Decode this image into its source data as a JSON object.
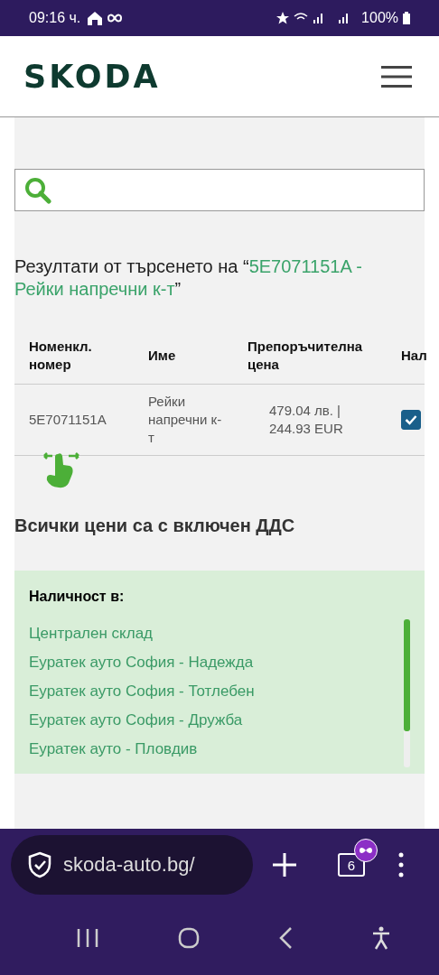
{
  "status_bar": {
    "time": "09:16 ч.",
    "battery": "100%"
  },
  "header": {
    "logo": "SKODA"
  },
  "results_heading": {
    "prefix": "Резултати от търсенето на “",
    "query": "5E7071151A - Рейки напречни к-т",
    "suffix": "”"
  },
  "table": {
    "columns": [
      "Номенкл. номер",
      "Име",
      "Препоръчителна цена",
      "Нал"
    ],
    "rows": [
      {
        "cells": [
          "5E7071151A",
          "Рейки напречни к-т",
          "479.04 лв. | 244.93 EUR"
        ],
        "checked": true
      }
    ]
  },
  "vat_note": "Всички цени са с включен ДДС",
  "availability": {
    "title": "Наличност в:",
    "items": [
      "Централен склад",
      "Еуратек ауто София - Надежда",
      "Еуратек ауто София - Тотлебен",
      "Еуратек ауто София - Дружба",
      "Еуратек ауто - Пловдив"
    ]
  },
  "browser": {
    "url": "skoda-auto.bg/",
    "tab_count": "6"
  }
}
